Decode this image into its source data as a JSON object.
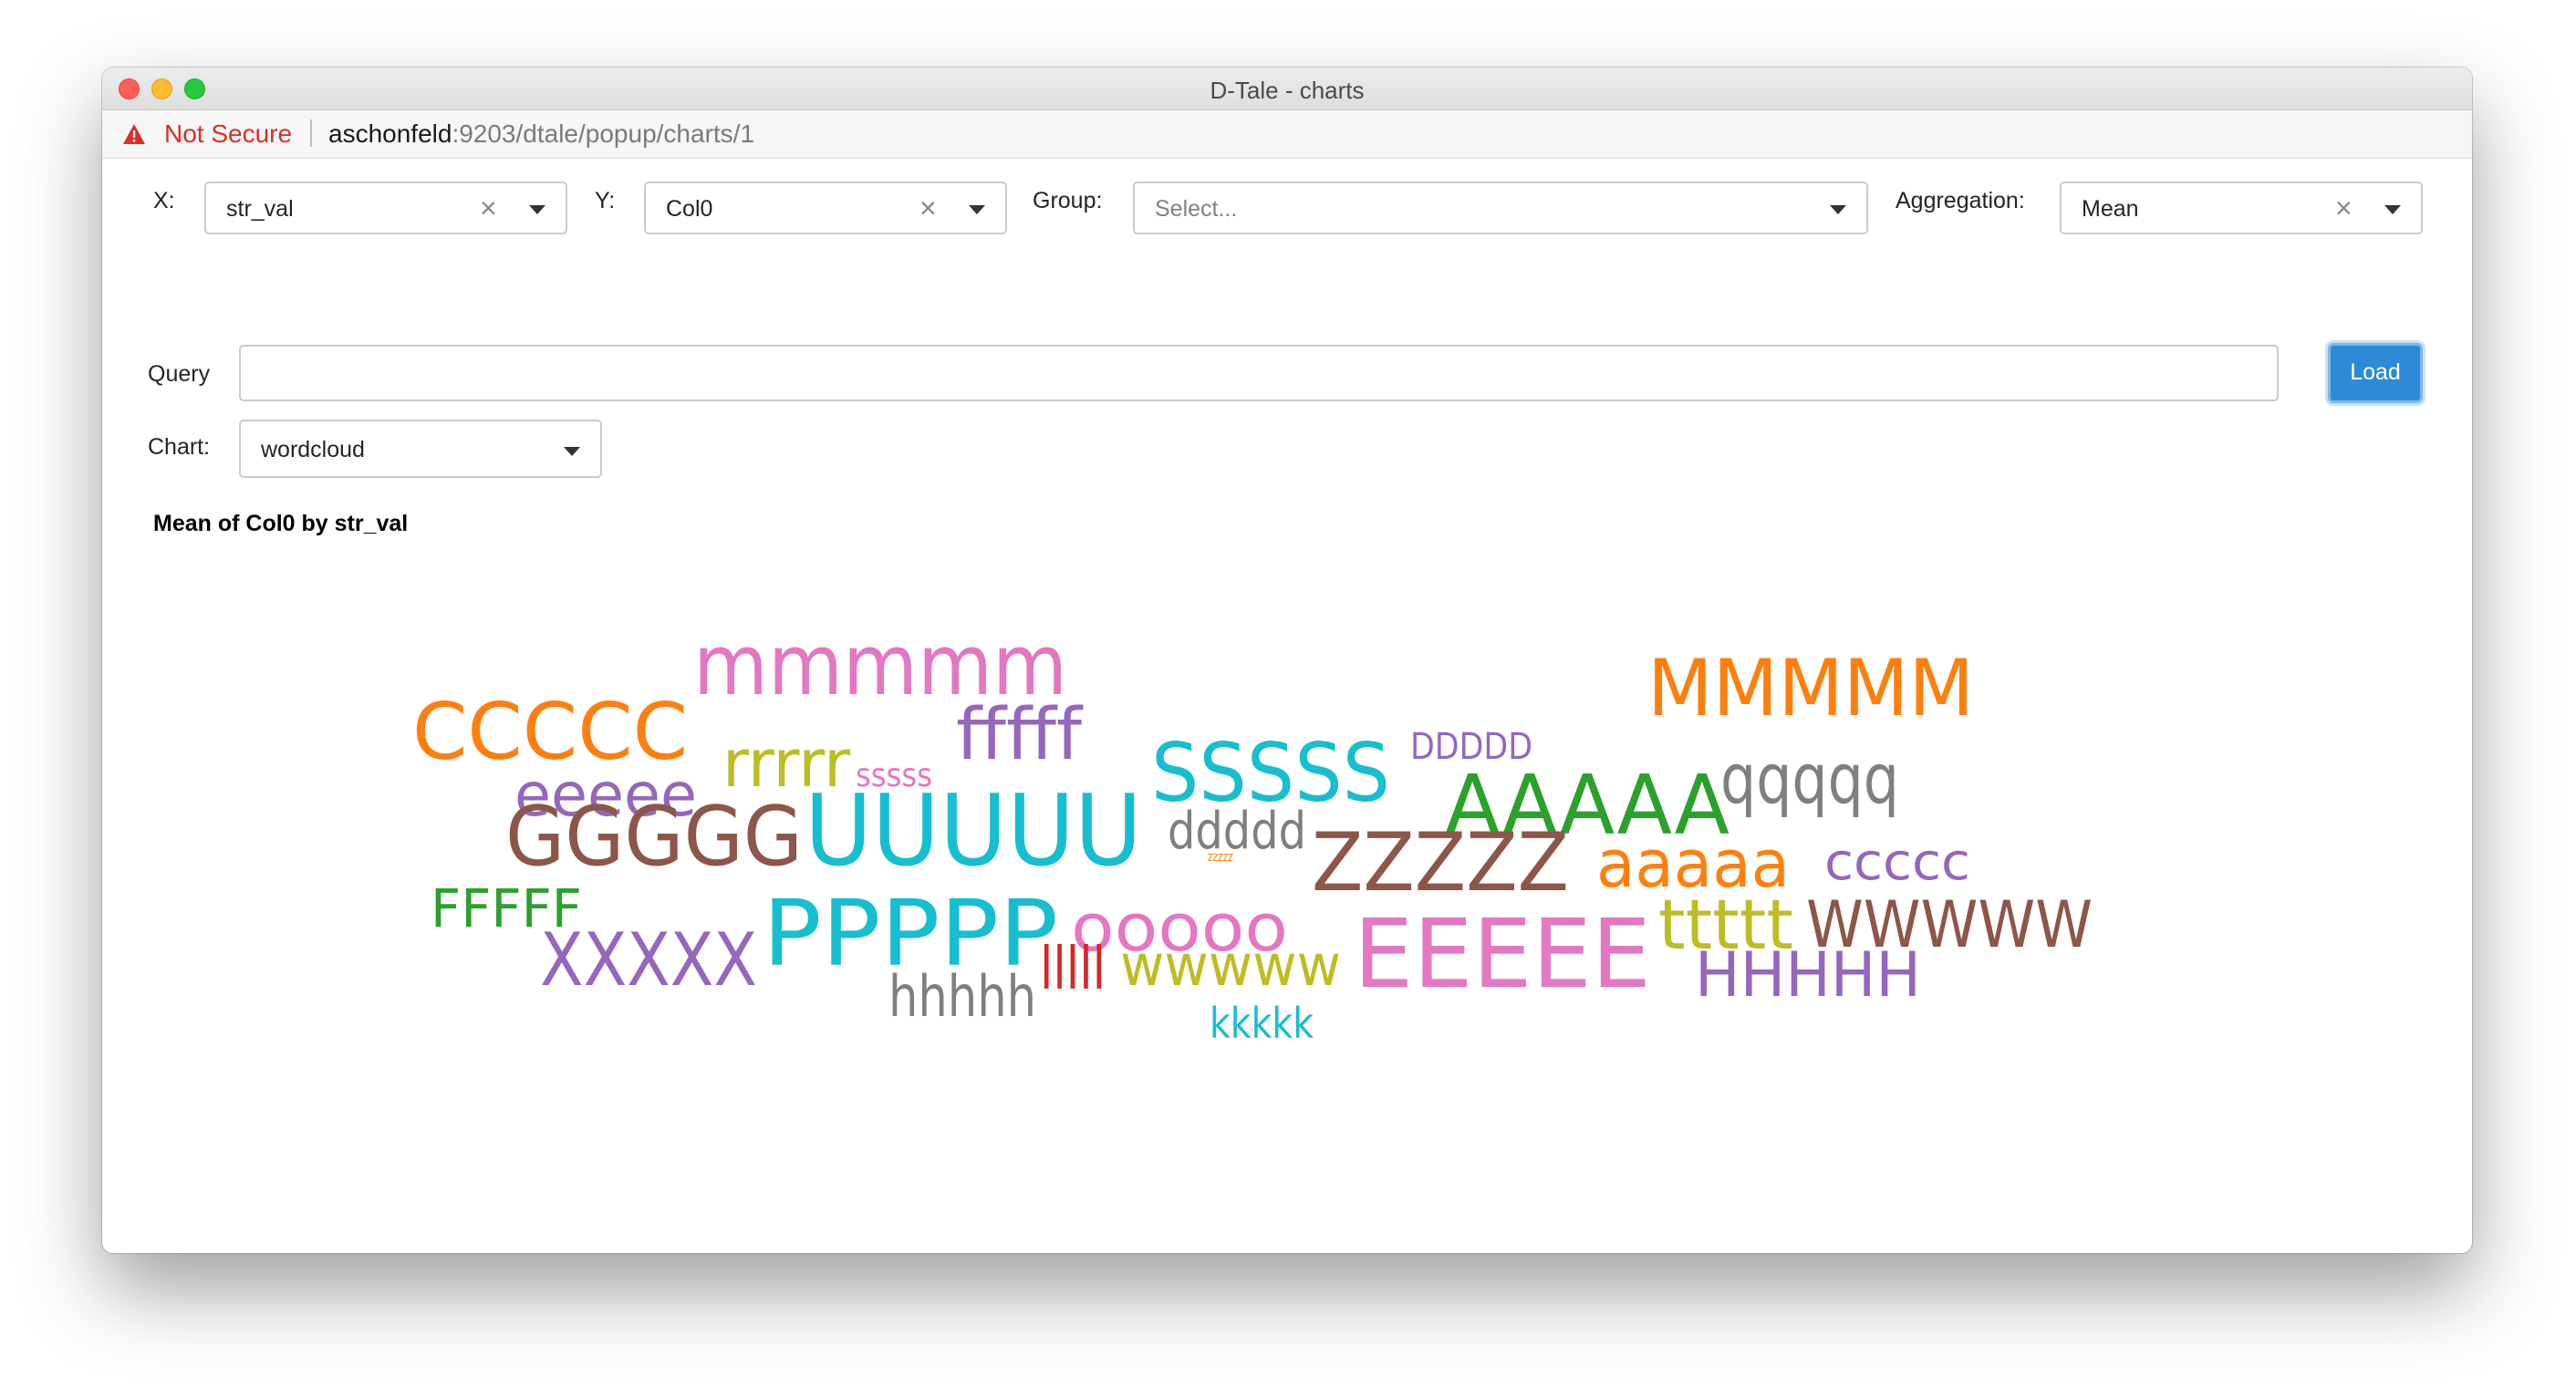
{
  "window": {
    "title": "D-Tale - charts"
  },
  "addressbar": {
    "security_label": "Not Secure",
    "url_host": "aschonfeld",
    "url_rest": ":9203/dtale/popup/charts/1"
  },
  "controls": {
    "x_label": "X:",
    "x_value": "str_val",
    "y_label": "Y:",
    "y_value": "Col0",
    "group_label": "Group:",
    "group_placeholder": "Select...",
    "aggregation_label": "Aggregation:",
    "aggregation_value": "Mean",
    "query_label": "Query",
    "query_value": "",
    "load_label": "Load",
    "chart_label": "Chart:",
    "chart_value": "wordcloud"
  },
  "chart_title": "Mean of Col0 by str_val",
  "chart_data": {
    "type": "wordcloud",
    "words": [
      {
        "text": "mmmmm",
        "color": "#e377c2"
      },
      {
        "text": "MMMMM",
        "color": "#ff7f0e"
      },
      {
        "text": "CCCCC",
        "color": "#ff7f0e"
      },
      {
        "text": "fffff",
        "color": "#9467bd"
      },
      {
        "text": "DDDDD",
        "color": "#9467bd"
      },
      {
        "text": "rrrrr",
        "color": "#bcbd22"
      },
      {
        "text": "sssss",
        "color": "#e377c2"
      },
      {
        "text": "SSSSS",
        "color": "#17becf"
      },
      {
        "text": "qqqqq",
        "color": "#7f7f7f"
      },
      {
        "text": "eeeee",
        "color": "#9467bd"
      },
      {
        "text": "AAAAA",
        "color": "#2ca02c"
      },
      {
        "text": "GGGGG",
        "color": "#8c564b"
      },
      {
        "text": "UUUUU",
        "color": "#17becf"
      },
      {
        "text": "ddddd",
        "color": "#7f7f7f"
      },
      {
        "text": "zzzzz",
        "color": "#ff7f0e"
      },
      {
        "text": "ZZZZZ",
        "color": "#8c564b"
      },
      {
        "text": "aaaaa",
        "color": "#ff7f0e"
      },
      {
        "text": "ccccc",
        "color": "#9467bd"
      },
      {
        "text": "FFFFF",
        "color": "#2ca02c"
      },
      {
        "text": "PPPPP",
        "color": "#17becf"
      },
      {
        "text": "ooooo",
        "color": "#e377c2"
      },
      {
        "text": "EEEEE",
        "color": "#e377c2"
      },
      {
        "text": "ttttt",
        "color": "#bcbd22"
      },
      {
        "text": "WWWWW",
        "color": "#8c564b"
      },
      {
        "text": "XXXXX",
        "color": "#9467bd"
      },
      {
        "text": "lllll",
        "color": "#d62728"
      },
      {
        "text": "wwwww",
        "color": "#bcbd22"
      },
      {
        "text": "HHHHH",
        "color": "#9467bd"
      },
      {
        "text": "hhhhh",
        "color": "#7f7f7f"
      },
      {
        "text": "kkkkk",
        "color": "#17becf"
      }
    ]
  }
}
